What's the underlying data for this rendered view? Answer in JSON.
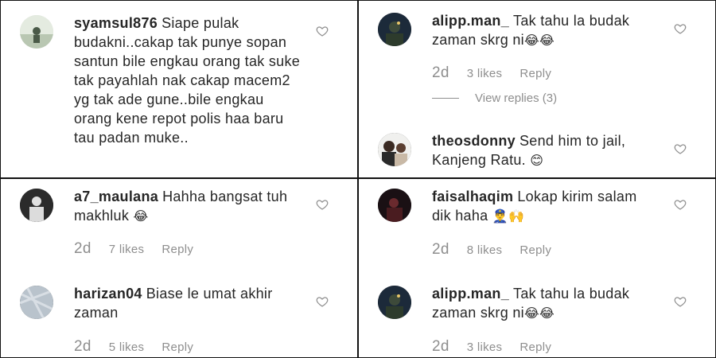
{
  "panels": {
    "tl": {
      "comments": [
        {
          "username": "syamsul876",
          "text": "Siape pulak budakni..cakap tak punye sopan santun bile engkau orang tak suke tak payahlah nak cakap macem2 yg tak ade gune..bile engkau orang kene repot polis haa baru tau padan muke.."
        }
      ]
    },
    "tr": {
      "comments": [
        {
          "username": "alipp.man_",
          "text": "Tak tahu la budak zaman skrg ni",
          "emoji": "😂😂",
          "age": "2d",
          "likes": "3 likes",
          "reply": "Reply",
          "view_replies": "View replies (3)"
        },
        {
          "username": "theosdonny",
          "text": "Send him to jail, Kanjeng Ratu.",
          "emoji": "😊"
        }
      ]
    },
    "bl": {
      "comments": [
        {
          "username": "a7_maulana",
          "text": "Hahha bangsat tuh makhluk",
          "emoji": "😂",
          "age": "2d",
          "likes": "7 likes",
          "reply": "Reply"
        },
        {
          "username": "harizan04",
          "text": "Biase le umat akhir zaman",
          "age": "2d",
          "likes": "5 likes",
          "reply": "Reply"
        }
      ]
    },
    "br": {
      "comments": [
        {
          "username": "faisalhaqim",
          "text": "Lokap kirim salam dik haha",
          "emoji": "👮‍♂️🙌",
          "age": "2d",
          "likes": "8 likes",
          "reply": "Reply"
        },
        {
          "username": "alipp.man_",
          "text": "Tak tahu la budak zaman skrg ni",
          "emoji": "😂😂",
          "age": "2d",
          "likes": "3 likes",
          "reply": "Reply"
        }
      ]
    }
  },
  "colors": {
    "text": "#262626",
    "muted": "#8e8e8e",
    "border": "#111111"
  },
  "icons": {
    "like": "heart-outline-icon"
  }
}
